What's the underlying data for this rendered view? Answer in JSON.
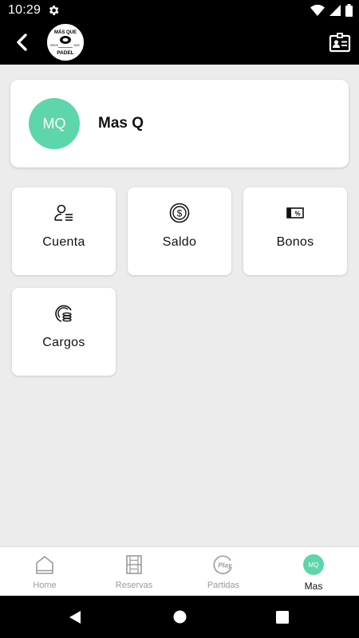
{
  "status_bar": {
    "time": "10:29"
  },
  "app_bar": {
    "back_icon": "chevron-left-icon",
    "logo": {
      "text_top": "MÁS QUE",
      "text_bottom": "PADEL",
      "text_left": "SINCE",
      "text_right": "2020"
    },
    "id_card_icon": "id-card-icon"
  },
  "profile": {
    "initials": "MQ",
    "name": "Mas Q",
    "avatar_color": "#5dd6a9"
  },
  "tiles": [
    {
      "label": "Cuenta",
      "icon": "account-icon"
    },
    {
      "label": "Saldo",
      "icon": "coin-icon"
    },
    {
      "label": "Bonos",
      "icon": "voucher-icon"
    },
    {
      "label": "Cargos",
      "icon": "charges-icon"
    }
  ],
  "bottom_nav": {
    "items": [
      {
        "label": "Home",
        "icon": "home-icon"
      },
      {
        "label": "Reservas",
        "icon": "reservations-icon"
      },
      {
        "label": "Partidas",
        "icon": "play-icon",
        "icon_text": "Play"
      },
      {
        "label": "Mas",
        "icon": "avatar",
        "initials": "MQ",
        "active": true
      }
    ]
  },
  "colors": {
    "accent": "#5dd6a9",
    "bar": "#000000",
    "background": "#ececec"
  }
}
